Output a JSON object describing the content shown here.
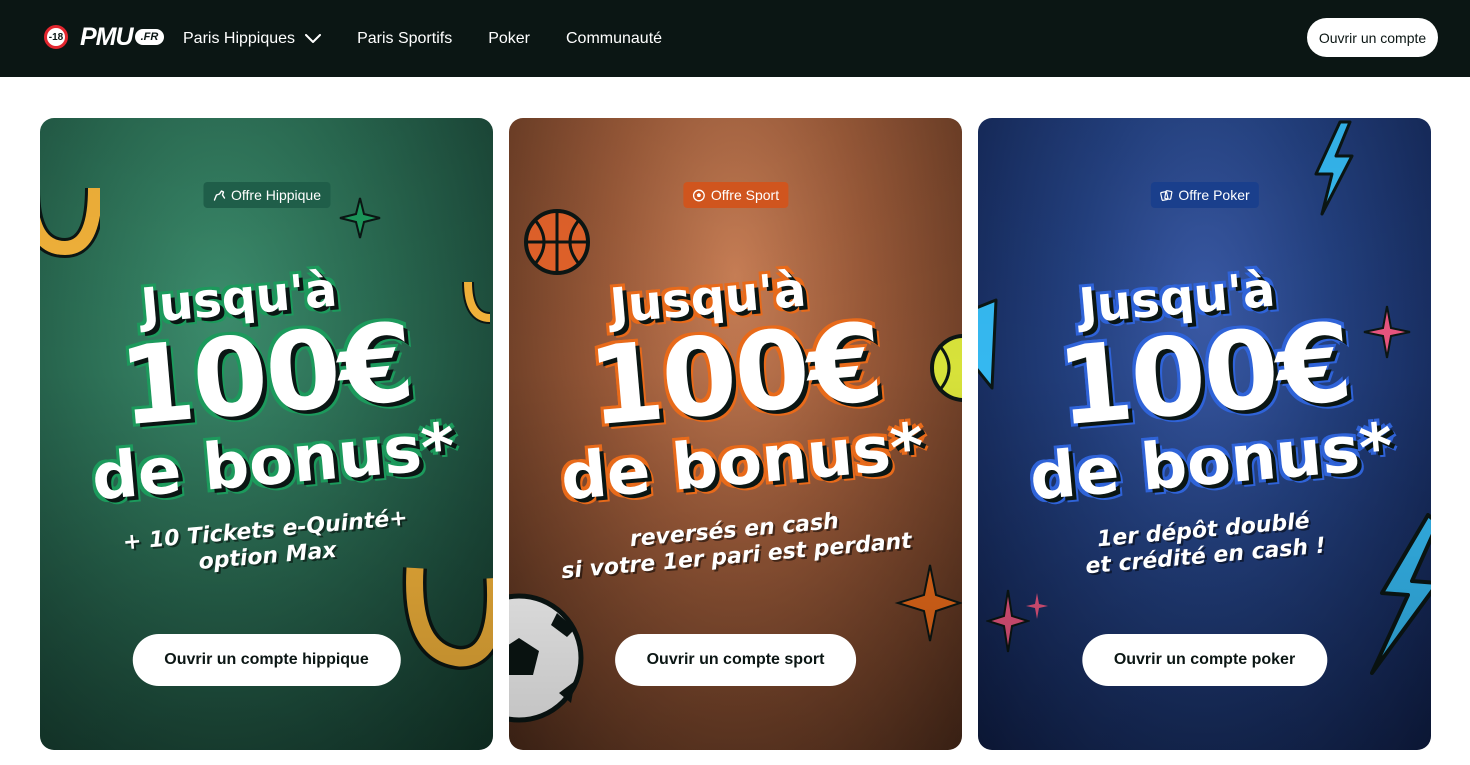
{
  "header": {
    "age_badge": "-18",
    "logo_main": "PMU",
    "logo_tld": ".FR",
    "nav": [
      {
        "label": "Paris Hippiques",
        "has_dropdown": true
      },
      {
        "label": "Paris Sportifs"
      },
      {
        "label": "Poker"
      },
      {
        "label": "Communauté"
      }
    ],
    "cta": "Ouvrir un compte"
  },
  "cards": [
    {
      "tag": "Offre Hippique",
      "tag_icon": "horse-icon",
      "headline_1": "Jusqu'à",
      "headline_2": "100€",
      "headline_3": "de bonus*",
      "sub_1": "+ 10 Tickets e-Quinté+",
      "sub_2": "option Max",
      "button": "Ouvrir un compte hippique",
      "accent": "#1c9a5c"
    },
    {
      "tag": "Offre Sport",
      "tag_icon": "soccer-ball-icon",
      "headline_1": "Jusqu'à",
      "headline_2": "100€",
      "headline_3": "de bonus*",
      "sub_1": "reversés en cash",
      "sub_2": "si votre 1er pari est perdant",
      "button": "Ouvrir un compte sport",
      "accent": "#e86a1a"
    },
    {
      "tag": "Offre Poker",
      "tag_icon": "cards-icon",
      "headline_1": "Jusqu'à",
      "headline_2": "100€",
      "headline_3": "de bonus*",
      "sub_1": "1er dépôt doublé",
      "sub_2": "et crédité en cash !",
      "button": "Ouvrir un compte poker",
      "accent": "#2f63d8"
    }
  ]
}
